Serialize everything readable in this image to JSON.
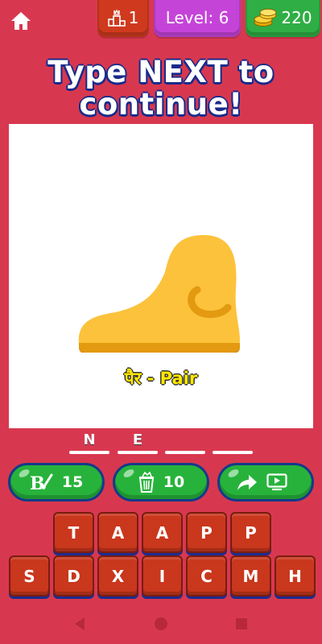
{
  "header": {
    "home_icon": "home-icon",
    "rank": {
      "icon": "podium-icon",
      "value": "1"
    },
    "level": {
      "label": "Level: 6"
    },
    "coins": {
      "icon": "coins-icon",
      "value": "220"
    }
  },
  "prompt": {
    "line1": "Type NEXT to",
    "line2": "continue!"
  },
  "picture": {
    "image": "foot-icon",
    "caption": "पैर -  Pair"
  },
  "answer": {
    "slots": [
      "N",
      "E",
      "",
      ""
    ]
  },
  "hints": {
    "reveal": {
      "icon": "brush-icon",
      "label": "15"
    },
    "remove": {
      "icon": "trash-icon",
      "label": "10"
    },
    "share": {
      "icon": "share-icon",
      "icon2": "tv-icon"
    }
  },
  "keyboard": {
    "row1": [
      "T",
      "A",
      "A",
      "P",
      "P"
    ],
    "row2": [
      "S",
      "D",
      "X",
      "I",
      "C",
      "M",
      "H"
    ]
  },
  "navigation": {
    "back": "back-icon",
    "home": "home-circle-icon",
    "recents": "recents-icon"
  },
  "colors": {
    "background": "#d8384f",
    "level_pill": "#c544d8",
    "coins_pill": "#2fae45",
    "rank_pill": "#cf3a1e",
    "hint_button": "#27b33b",
    "key": "#c9371d",
    "caption": "#ffe800"
  }
}
